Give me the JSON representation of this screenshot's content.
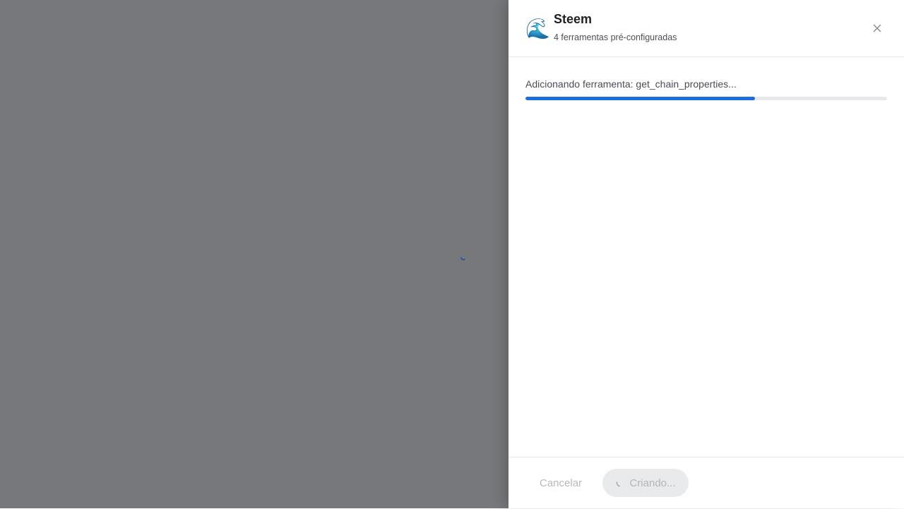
{
  "tool": {
    "icon": "🌊",
    "icon_name": "wave-icon",
    "title": "Steem",
    "subtitle": "4 ferramentas pré-configuradas"
  },
  "progress": {
    "label": "Adicionando ferramenta: get_chain_properties...",
    "fraction": 0.635
  },
  "footer": {
    "cancel_label": "Cancelar",
    "create_label": "Criando..."
  },
  "colors": {
    "accent": "#1a6fd8",
    "overlay": "#77787b"
  }
}
